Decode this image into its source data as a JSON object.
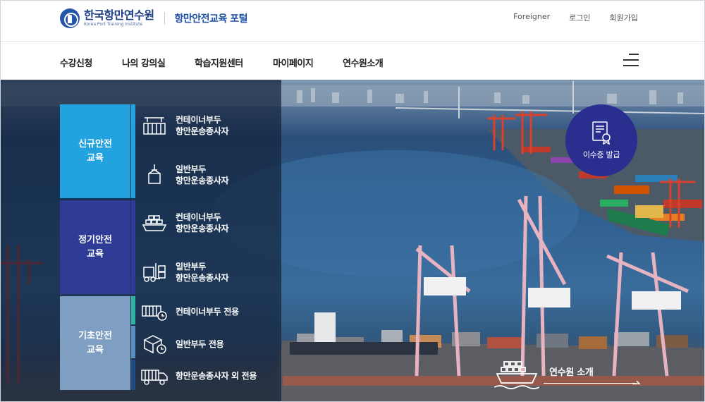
{
  "brand": {
    "name_ko": "한국항만연수원",
    "name_en": "Korea Port Training Institute",
    "portal": "항만안전교육 포털"
  },
  "utility": [
    "Foreigner",
    "로그인",
    "회원가입"
  ],
  "nav": [
    "수강신청",
    "나의 강의실",
    "학습지원센터",
    "마이페이지",
    "연수원소개"
  ],
  "menu": {
    "categories": [
      {
        "label_1": "신규안전",
        "label_2": "교육",
        "color": "#23a2e0"
      },
      {
        "label_1": "정기안전",
        "label_2": "교육",
        "color": "#2e3c97"
      },
      {
        "label_1": "기초안전",
        "label_2": "교육",
        "color": "#7e9fc1"
      }
    ],
    "items": [
      {
        "line_1": "컨테이너부두",
        "line_2": "항만운송종사자",
        "icon": "container-crane-icon"
      },
      {
        "line_1": "일반부두",
        "line_2": "항만운송종사자",
        "icon": "cargo-hook-icon"
      },
      {
        "line_1": "컨테이너부두",
        "line_2": "항만운송종사자",
        "icon": "container-ship-icon"
      },
      {
        "line_1": "일반부두",
        "line_2": "항만운송종사자",
        "icon": "forklift-icon"
      },
      {
        "line_1": "컨테이너부두 전용",
        "icon": "container-clock-icon"
      },
      {
        "line_1": "일반부두 전용",
        "icon": "box-clock-icon"
      },
      {
        "line_1": "항만운송종사자 외 전용",
        "icon": "truck-icon"
      }
    ]
  },
  "cert": {
    "label": "이수증 발급",
    "icon": "certificate-icon"
  },
  "intro": {
    "label": "연수원 소개",
    "icon": "ship-icon"
  }
}
